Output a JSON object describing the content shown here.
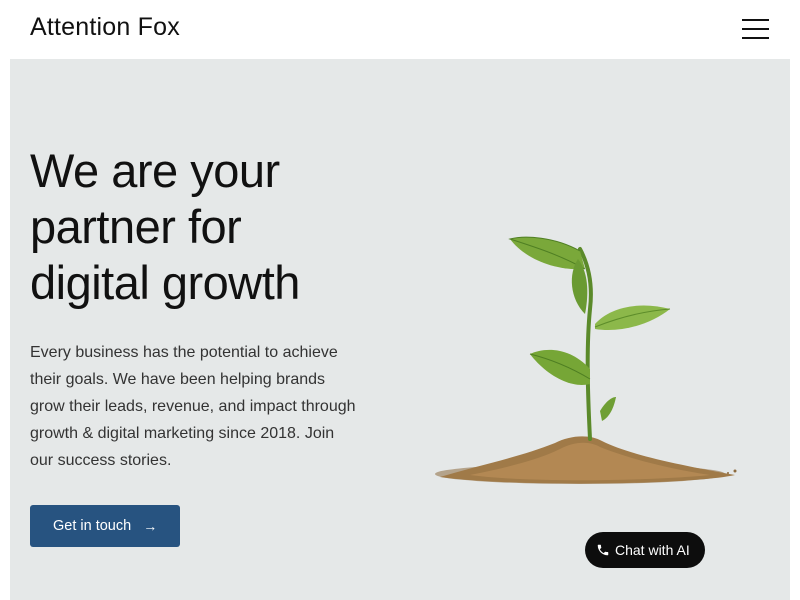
{
  "header": {
    "logo_text": "Attention Fox",
    "menu_icon": "hamburger-menu-icon"
  },
  "hero": {
    "title_lines": [
      "We are your",
      "partner for",
      "digital growth"
    ],
    "description": "Every business has the potential to achieve their goals. We have been helping brands grow their leads, revenue, and impact through growth & digital marketing since 2018. Join our success stories.",
    "cta_label": "Get in touch",
    "cta_icon": "arrow-right-icon",
    "image": "plant-sprout-in-soil"
  },
  "chat": {
    "label": "Chat with AI",
    "icon": "phone-icon"
  },
  "colors": {
    "hero_background": "#e5e8e8",
    "cta_background": "#275380",
    "chat_background": "#0d0d0d",
    "text_dark": "#111111"
  }
}
